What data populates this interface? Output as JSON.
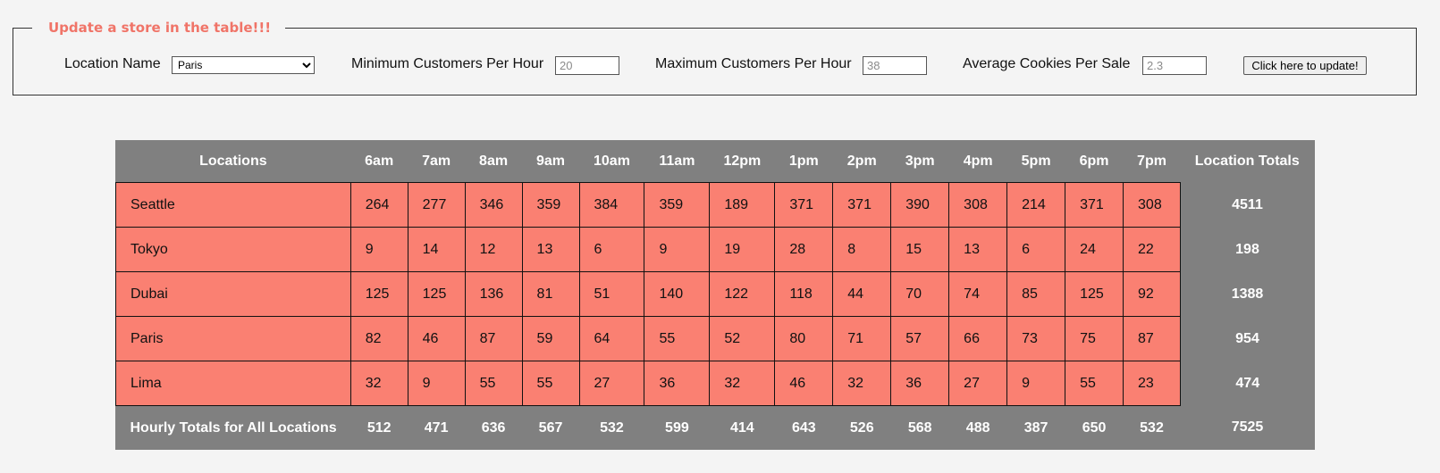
{
  "form": {
    "legend": "Update a store in the table!!!",
    "location_label": "Location Name",
    "location_selected": "Paris",
    "min_label": "Minimum Customers Per Hour",
    "min_placeholder": "20",
    "max_label": "Maximum Customers Per Hour",
    "max_placeholder": "38",
    "avg_label": "Average Cookies Per Sale",
    "avg_placeholder": "2.3",
    "button_label": "Click here to update!"
  },
  "table": {
    "headers": [
      "Locations",
      "6am",
      "7am",
      "8am",
      "9am",
      "10am",
      "11am",
      "12pm",
      "1pm",
      "2pm",
      "3pm",
      "4pm",
      "5pm",
      "6pm",
      "7pm",
      "Location Totals"
    ],
    "rows": [
      {
        "location": "Seattle",
        "values": [
          "264",
          "277",
          "346",
          "359",
          "384",
          "359",
          "189",
          "371",
          "371",
          "390",
          "308",
          "214",
          "371",
          "308"
        ],
        "total": "4511"
      },
      {
        "location": "Tokyo",
        "values": [
          "9",
          "14",
          "12",
          "13",
          "6",
          "9",
          "19",
          "28",
          "8",
          "15",
          "13",
          "6",
          "24",
          "22"
        ],
        "total": "198"
      },
      {
        "location": "Dubai",
        "values": [
          "125",
          "125",
          "136",
          "81",
          "51",
          "140",
          "122",
          "118",
          "44",
          "70",
          "74",
          "85",
          "125",
          "92"
        ],
        "total": "1388"
      },
      {
        "location": "Paris",
        "values": [
          "82",
          "46",
          "87",
          "59",
          "64",
          "55",
          "52",
          "80",
          "71",
          "57",
          "66",
          "73",
          "75",
          "87"
        ],
        "total": "954"
      },
      {
        "location": "Lima",
        "values": [
          "32",
          "9",
          "55",
          "55",
          "27",
          "36",
          "32",
          "46",
          "32",
          "36",
          "27",
          "9",
          "55",
          "23"
        ],
        "total": "474"
      }
    ],
    "footer": {
      "label": "Hourly Totals for All Locations",
      "values": [
        "512",
        "471",
        "636",
        "567",
        "532",
        "599",
        "414",
        "643",
        "526",
        "568",
        "488",
        "387",
        "650",
        "532"
      ],
      "total": "7525"
    }
  },
  "colors": {
    "legend": "#f07468",
    "cell": "#fa8072",
    "table_bg": "#808080"
  }
}
